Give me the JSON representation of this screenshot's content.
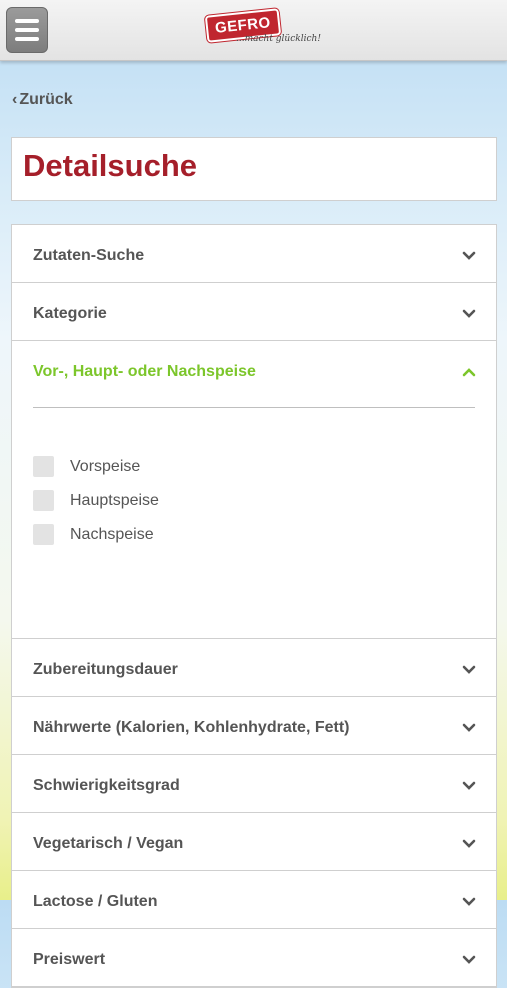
{
  "header": {
    "logo_text": "GEFRO",
    "logo_tagline": "...macht glücklich!"
  },
  "nav": {
    "back_label": "Zurück"
  },
  "page": {
    "title": "Detailsuche"
  },
  "accordion": {
    "items": [
      {
        "label": "Zutaten-Suche",
        "open": false
      },
      {
        "label": "Kategorie",
        "open": false
      },
      {
        "label": "Vor-, Haupt- oder Nachspeise",
        "open": true,
        "options": [
          {
            "label": "Vorspeise",
            "checked": false
          },
          {
            "label": "Hauptspeise",
            "checked": false
          },
          {
            "label": "Nachspeise",
            "checked": false
          }
        ]
      },
      {
        "label": "Zubereitungsdauer",
        "open": false
      },
      {
        "label": "Nährwerte (Kalorien, Kohlenhydrate, Fett)",
        "open": false
      },
      {
        "label": "Schwierigkeitsgrad",
        "open": false
      },
      {
        "label": "Vegetarisch / Vegan",
        "open": false
      },
      {
        "label": "Lactose / Gluten",
        "open": false
      },
      {
        "label": "Preiswert",
        "open": false
      }
    ]
  },
  "colors": {
    "title_red": "#a51f2a",
    "open_green": "#7cc62b",
    "label_gray": "#555555"
  }
}
